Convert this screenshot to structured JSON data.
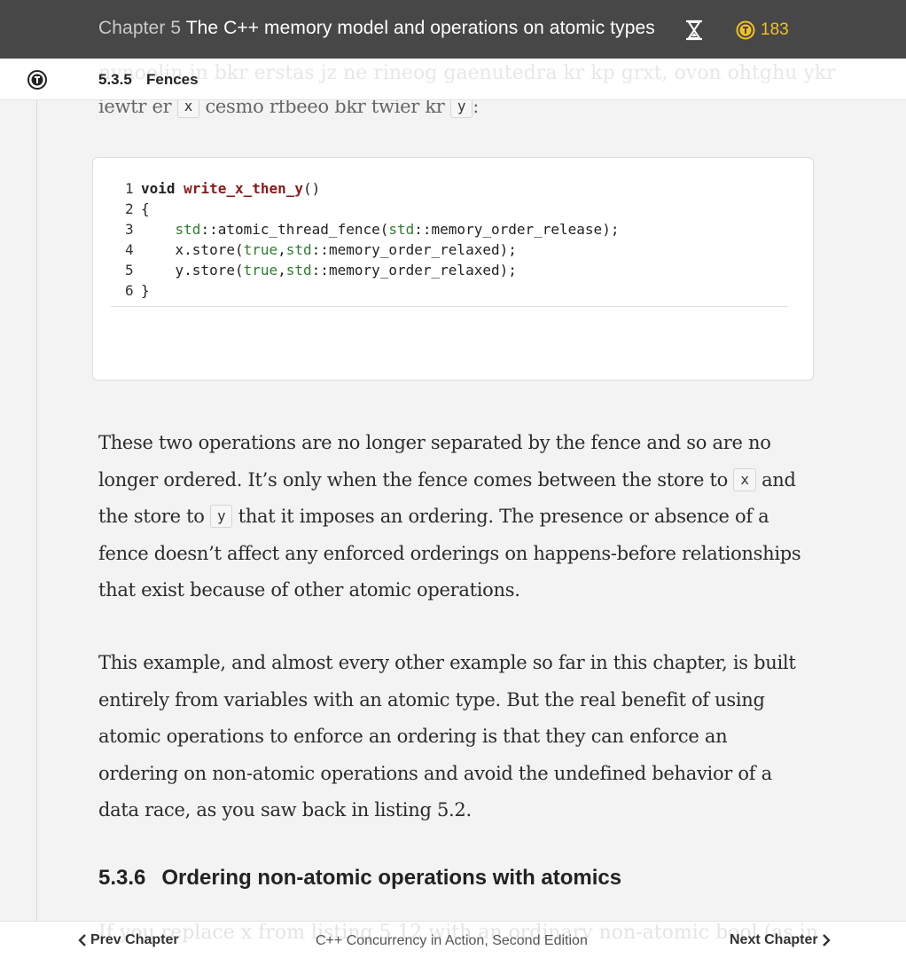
{
  "header": {
    "chapter_number": "Chapter 5",
    "chapter_title": "The C++ memory model and operations on atomic types",
    "timer_icon": "hourglass-icon",
    "token_icon": "token-coin-icon",
    "token_count": "183",
    "accent_color": "#f2c221"
  },
  "subheader": {
    "badge_icon": "table-of-contents-icon",
    "section_number": "5.3.5",
    "section_title": "Fences"
  },
  "content": {
    "intro_fragment": {
      "text_before": "iewtr er",
      "code_x": "x",
      "text_middle": "cesmo rfbeeo bkr twier kr",
      "code_y": "y",
      "text_after": ":"
    },
    "code_listing": {
      "lines": [
        {
          "num": "1",
          "keyword": "void",
          "function": "write_x_then_y",
          "rest": "()"
        },
        {
          "num": "2",
          "text": "{"
        },
        {
          "num": "3",
          "ns1": "std",
          "mid1": "::atomic_thread_fence(",
          "ns2": "std",
          "mid2": "::memory_order_release);"
        },
        {
          "num": "4",
          "pre": "x.store(",
          "lit": "true",
          "comma": ",",
          "ns": "std",
          "post": "::memory_order_relaxed);"
        },
        {
          "num": "5",
          "pre": "y.store(",
          "lit": "true",
          "comma": ",",
          "ns": "std",
          "post": "::memory_order_relaxed);"
        },
        {
          "num": "6",
          "text": "}"
        }
      ]
    },
    "paragraph1": {
      "part1": "These two operations are no longer separated by the fence and so are no longer ordered. It’s only when the fence comes between the store to",
      "code_x": "x",
      "part2": "and the store to",
      "code_y": "y",
      "part3": "that it imposes an ordering. The presence or absence of a fence doesn’t affect any enforced orderings on happens-before relationships that exist because of other atomic operations."
    },
    "paragraph2": "This example, and almost every other example so far in this chapter, is built entirely from variables with an atomic type. But the real benefit of using atomic operations to enforce an ordering is that they can enforce an ordering on non-atomic operations and avoid the undefined behavior of a data race, as you saw back in listing 5.2.",
    "section_heading": {
      "number": "5.3.6",
      "title": "Ordering non-atomic operations with atomics"
    }
  },
  "footer": {
    "prev_label": "Prev Chapter",
    "next_label": "Next Chapter",
    "book_title": "C++ Concurrency in Action, Second Edition"
  }
}
